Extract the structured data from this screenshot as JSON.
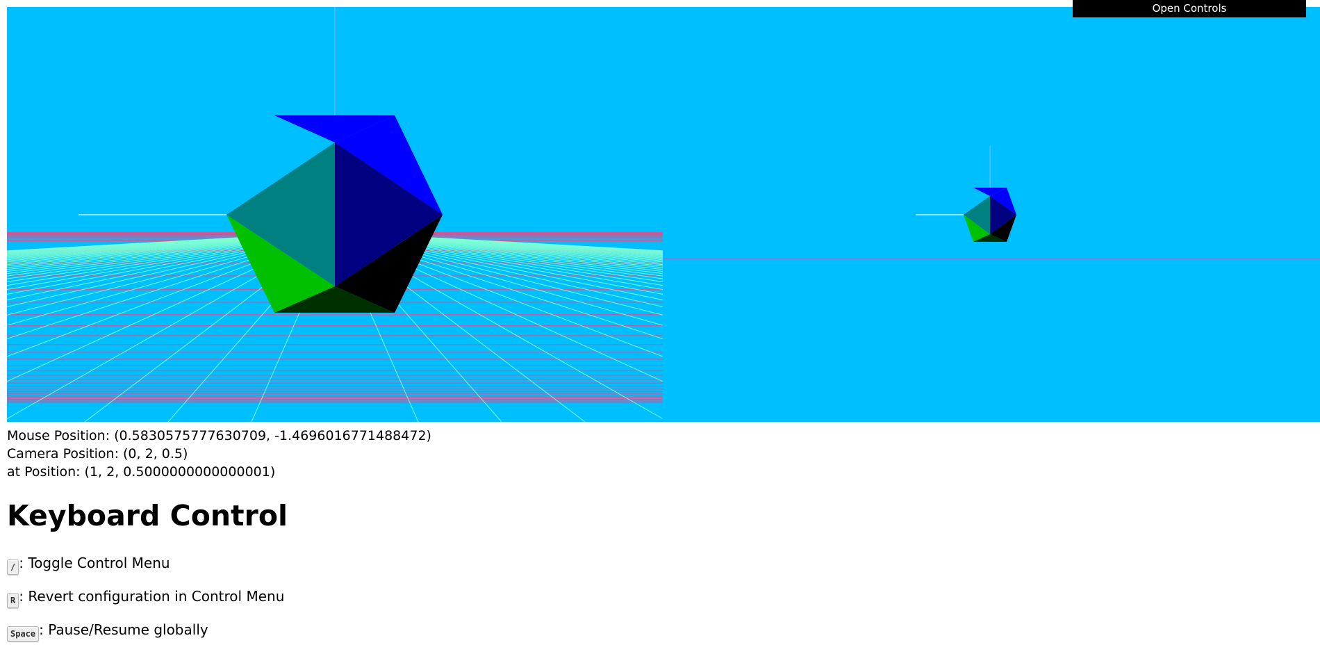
{
  "controls": {
    "open_label": "Open Controls"
  },
  "scene": {
    "background_color": "#00bfff",
    "grid_colors": {
      "horizontal": "#ff3d7f",
      "radial": "#7fffd4"
    },
    "face_colors": [
      "#0000ff",
      "#000080",
      "#008080",
      "#00c000",
      "#000000",
      "#003000"
    ],
    "icon": "icosahedron-shape"
  },
  "info": {
    "mouse_position": "Mouse Position: (0.5830575777630709, -1.4696016771488472)",
    "camera_position": "Camera Position: (0, 2, 0.5)",
    "at_position": "at Position: (1, 2, 0.5000000000000001)"
  },
  "keyboard": {
    "title": "Keyboard Control",
    "items": [
      {
        "key": "/",
        "description": ": Toggle Control Menu"
      },
      {
        "key": "R",
        "description": ": Revert configuration in Control Menu"
      },
      {
        "key": "Space",
        "description": ": Pause/Resume globally"
      }
    ]
  }
}
